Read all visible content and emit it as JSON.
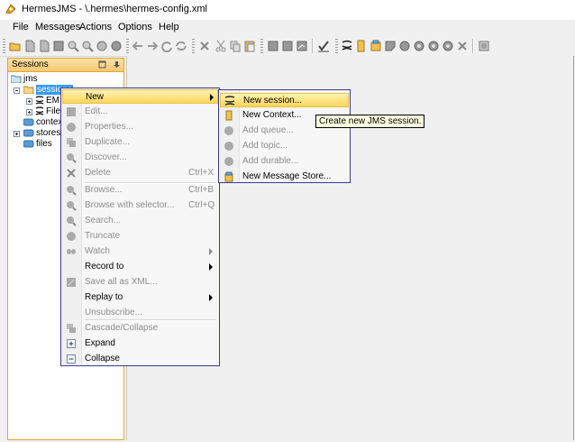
{
  "window": {
    "title": "HermesJMS - \\.hermes\\hermes-config.xml"
  },
  "menubar": {
    "items": [
      "File",
      "Messages",
      "Actions",
      "Options",
      "Help"
    ]
  },
  "toolbar": {
    "icons": [
      "open-icon",
      "document-icon",
      "document-icon",
      "stop-icon",
      "search-icon",
      "zoom-icon",
      "clock-icon",
      "circle-icon",
      "back-icon",
      "forward-icon",
      "refresh-icon",
      "sync-icon",
      "delete-icon",
      "cut-icon",
      "copy-icon",
      "paste-icon",
      "list-icon",
      "list-icon",
      "chart-icon",
      "check-icon",
      "session-icon",
      "context-icon",
      "store-icon",
      "browse-icon",
      "watch-icon",
      "queue-icon",
      "topic-icon",
      "durable-icon",
      "delete-icon",
      "settings-icon"
    ]
  },
  "sessions_panel": {
    "title": "Sessions",
    "tree": {
      "root": "jms",
      "sessions_node": "sessions",
      "children": [
        "EM",
        "File"
      ],
      "contexts_node": "contexts",
      "stores_node": "stores",
      "files_node": "files"
    }
  },
  "context_menu": {
    "items": [
      {
        "label": "New",
        "enabled": true,
        "submenu": true,
        "highlighted": true,
        "icon": ""
      },
      {
        "label": "Edit...",
        "enabled": false,
        "icon": "edit-icon"
      },
      {
        "label": "Properties...",
        "enabled": false,
        "icon": "properties-icon"
      },
      {
        "label": "Duplicate...",
        "enabled": false,
        "icon": "duplicate-icon"
      },
      {
        "label": "Discover...",
        "enabled": false,
        "icon": "discover-icon"
      },
      {
        "label": "Delete",
        "enabled": false,
        "shortcut": "Ctrl+X",
        "icon": "delete-icon"
      },
      {
        "label": "Browse...",
        "enabled": false,
        "shortcut": "Ctrl+B",
        "icon": "browse-icon"
      },
      {
        "label": "Browse with selector...",
        "enabled": false,
        "shortcut": "Ctrl+Q",
        "icon": "browse-selector-icon"
      },
      {
        "label": "Search...",
        "enabled": false,
        "icon": "search-icon"
      },
      {
        "label": "Truncate",
        "enabled": false,
        "icon": "truncate-icon"
      },
      {
        "label": "Watch",
        "enabled": false,
        "submenu": true,
        "icon": "watch-icon"
      },
      {
        "label": "Record to",
        "enabled": true,
        "submenu": true,
        "icon": ""
      },
      {
        "label": "Save all as XML...",
        "enabled": false,
        "icon": "save-xml-icon"
      },
      {
        "label": "Replay to",
        "enabled": true,
        "submenu": true,
        "icon": ""
      },
      {
        "label": "Unsubscribe...",
        "enabled": false,
        "icon": ""
      },
      {
        "label": "Cascade/Collapse",
        "enabled": false,
        "icon": "cascade-icon"
      },
      {
        "label": "Expand",
        "enabled": true,
        "icon": "expand-icon"
      },
      {
        "label": "Collapse",
        "enabled": true,
        "icon": "collapse-icon"
      }
    ]
  },
  "submenu": {
    "items": [
      {
        "label": "New session...",
        "enabled": true,
        "highlighted": true,
        "icon": "session-icon"
      },
      {
        "label": "New Context...",
        "enabled": true,
        "icon": "context-icon"
      },
      {
        "label": "Add queue...",
        "enabled": false,
        "icon": "queue-icon"
      },
      {
        "label": "Add topic...",
        "enabled": false,
        "icon": "topic-icon"
      },
      {
        "label": "Add durable...",
        "enabled": false,
        "icon": "durable-icon"
      },
      {
        "label": "New Message Store...",
        "enabled": true,
        "icon": "store-icon"
      }
    ]
  },
  "tooltip": {
    "text": "Create new JMS session."
  },
  "colors": {
    "highlight": "#f9d65c",
    "menu_border": "#3a3a92",
    "panel_border": "#e8a430"
  }
}
